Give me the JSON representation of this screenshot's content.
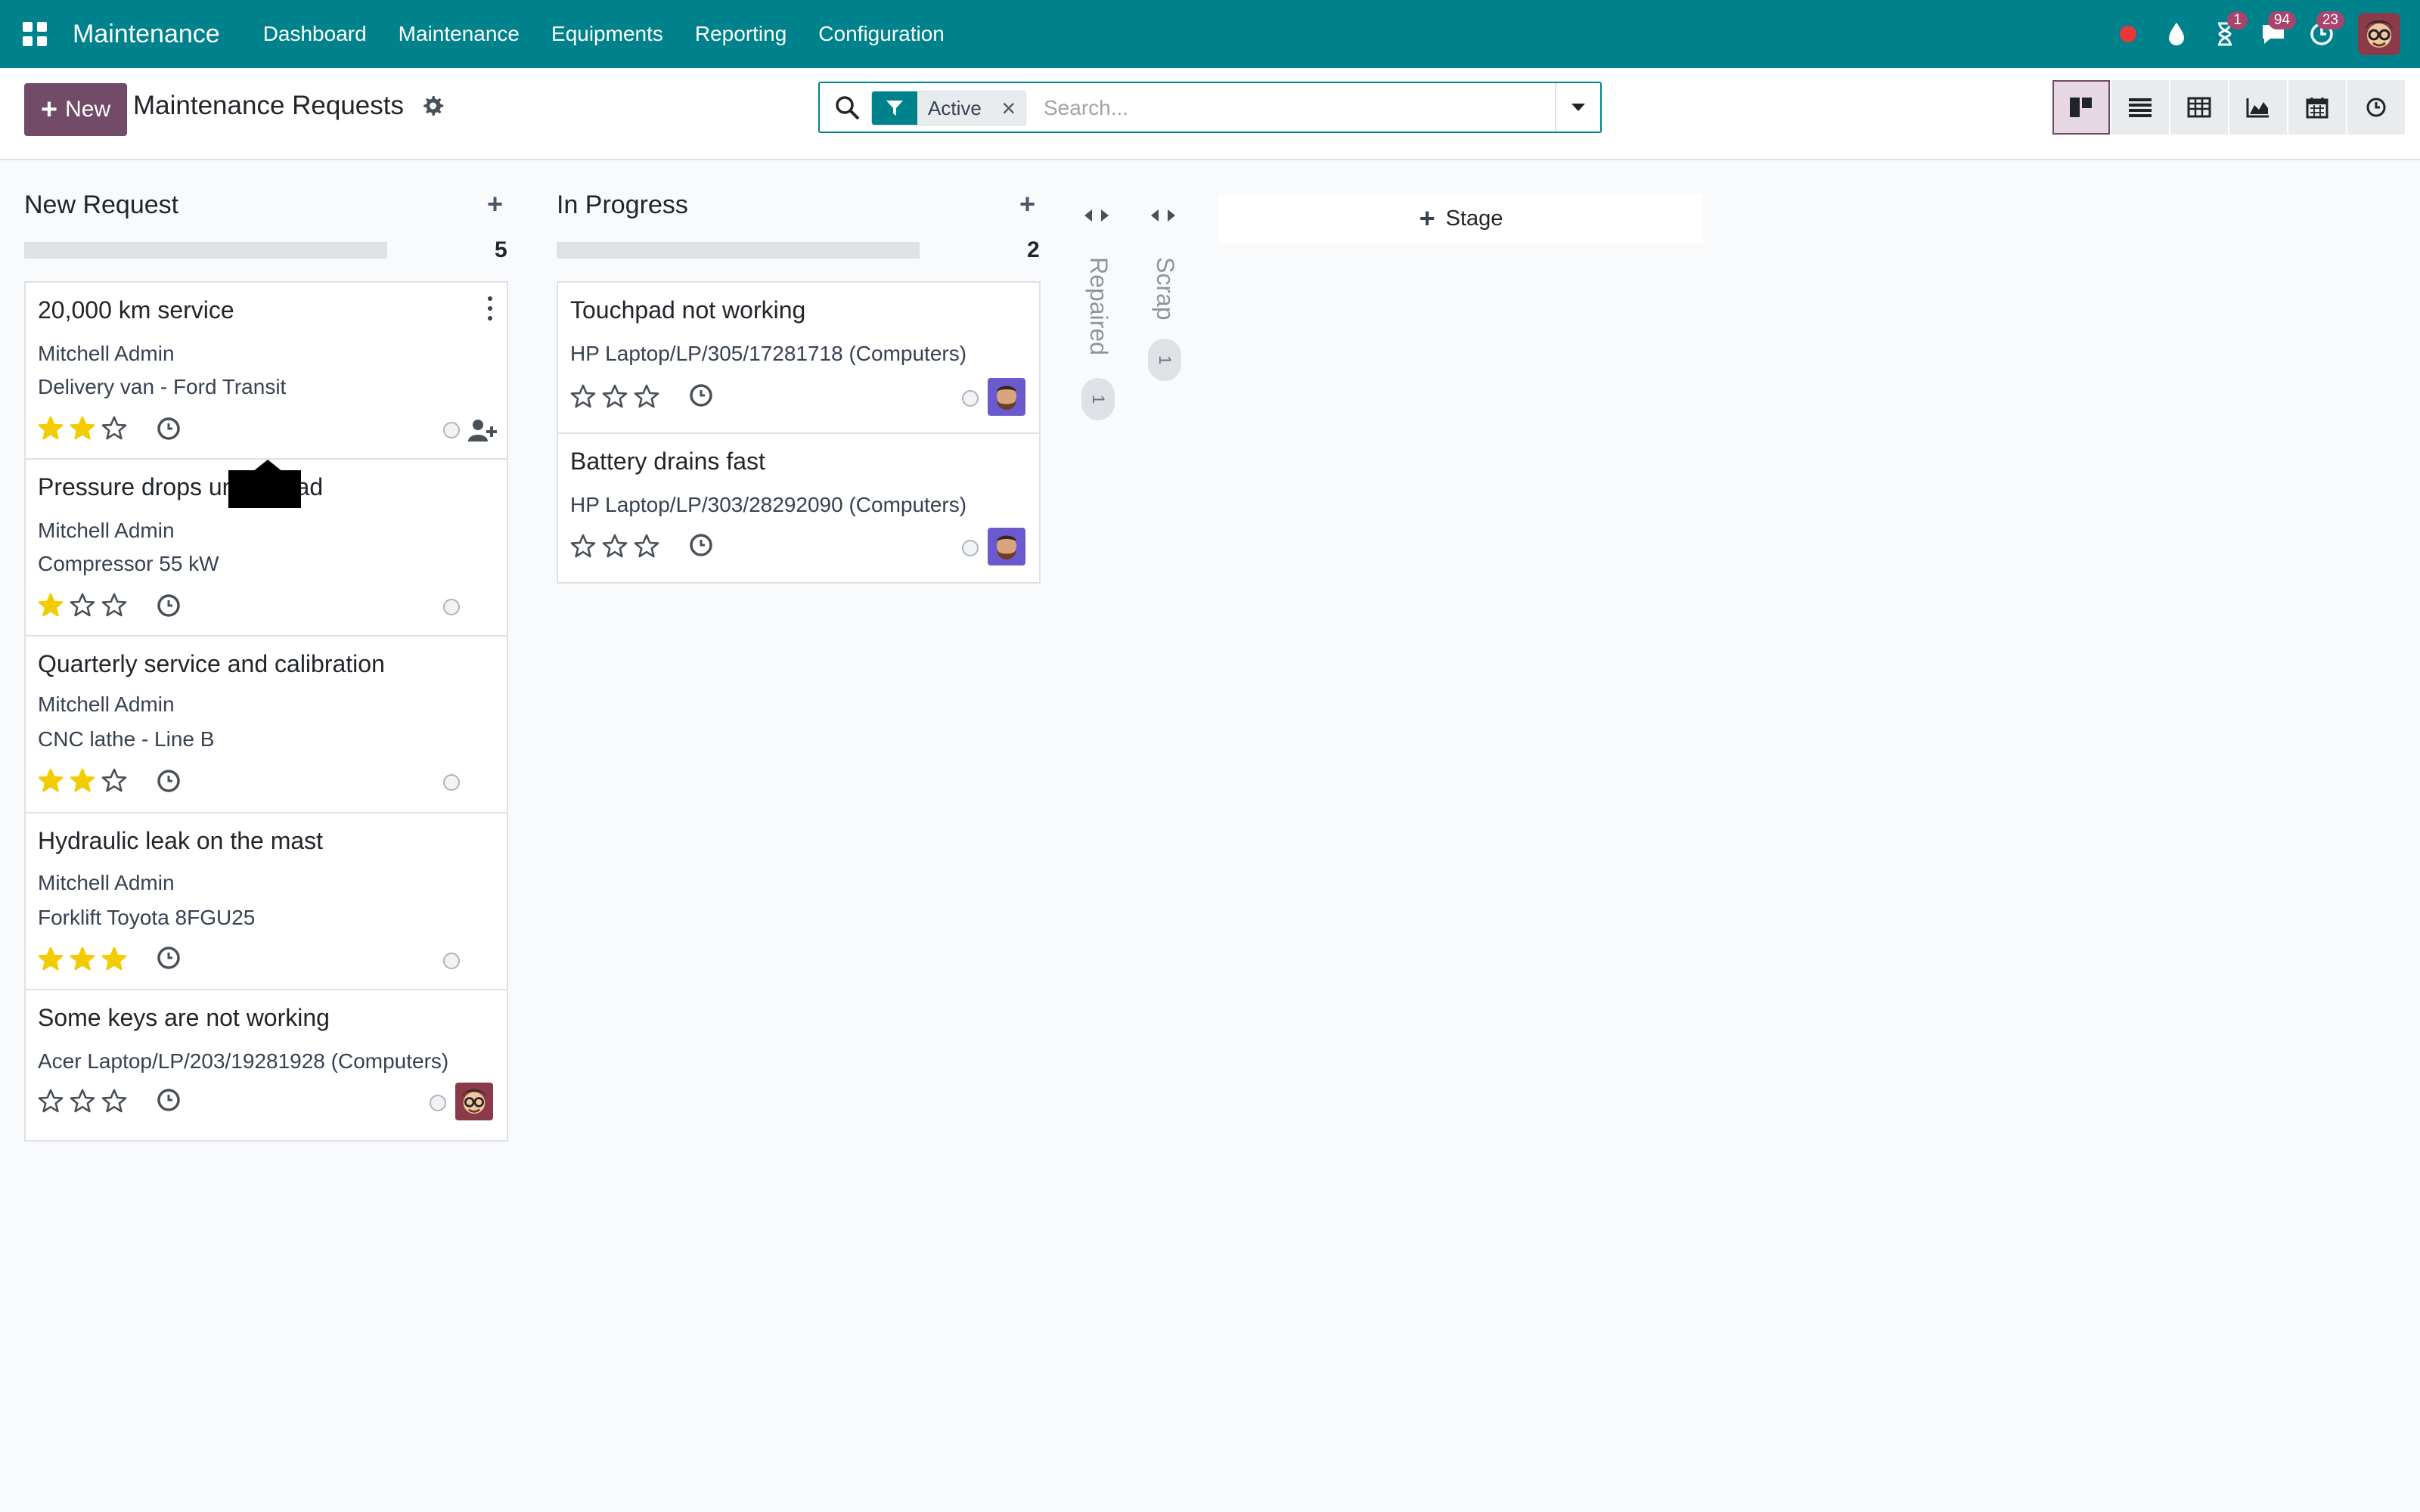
{
  "navbar": {
    "app_name": "Maintenance",
    "menu": [
      "Dashboard",
      "Maintenance",
      "Equipments",
      "Reporting",
      "Configuration"
    ],
    "activity_badge": "1",
    "messages_badge": "94",
    "clock_badge": "23",
    "accent_color": "#00828c"
  },
  "control": {
    "new_label": "New",
    "title": "Maintenance Requests",
    "facet_label": "Active",
    "search_placeholder": "Search...",
    "views": [
      "kanban",
      "list",
      "pivot",
      "graph",
      "calendar",
      "activity"
    ],
    "active_view": "kanban",
    "brand_color": "#714b67"
  },
  "columns": [
    {
      "title": "New Request",
      "count": "5",
      "cards": [
        {
          "title": "20,000 km service",
          "lines": [
            "Mitchell Admin",
            "Delivery van - Ford Transit"
          ],
          "stars": 2
        },
        {
          "title": "Pressure drops under load",
          "lines": [
            "Mitchell Admin",
            "Compressor 55 kW"
          ],
          "stars": 1
        },
        {
          "title": "Quarterly service and calibration",
          "lines": [
            "Mitchell Admin",
            "CNC lathe - Line B"
          ],
          "stars": 2
        },
        {
          "title": "Hydraulic leak on the mast",
          "lines": [
            "Mitchell Admin",
            "Forklift Toyota 8FGU25"
          ],
          "stars": 3
        },
        {
          "title": "Some keys are not working",
          "lines": [
            "Acer Laptop/LP/203/19281928 (Computers)"
          ],
          "stars": 0
        }
      ]
    },
    {
      "title": "In Progress",
      "count": "2",
      "cards": [
        {
          "title": "Touchpad not working",
          "lines": [
            "HP Laptop/LP/305/17281718 (Computers)"
          ],
          "stars": 0
        },
        {
          "title": "Battery drains fast",
          "lines": [
            "HP Laptop/LP/303/28292090 (Computers)"
          ],
          "stars": 0
        }
      ]
    }
  ],
  "folded": [
    {
      "title": "Repaired",
      "count": "1"
    },
    {
      "title": "Scrap",
      "count": "1"
    }
  ],
  "stage_button": "Stage"
}
